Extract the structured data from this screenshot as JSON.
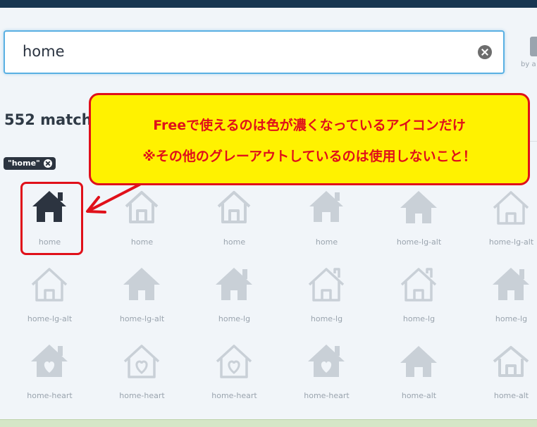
{
  "search": {
    "value": "home"
  },
  "sort": {
    "label": "by a"
  },
  "results": {
    "count_text": "552 matchi"
  },
  "tag": {
    "label": "\"home\""
  },
  "callout": {
    "line1": "Freeで使えるのは色が濃くなっているアイコンだけ",
    "line2": "※その他のグレーアウトしているのは使用しないこと！"
  },
  "colors": {
    "accent": "#e0101a",
    "callout_bg": "#fff200",
    "active_icon": "#2c3440",
    "inactive_icon": "#c9d0d7"
  },
  "icons": [
    {
      "label": "home",
      "icon": "home-solid-icon",
      "free": true
    },
    {
      "label": "home",
      "icon": "home-outline-icon",
      "free": false
    },
    {
      "label": "home",
      "icon": "home-outline-icon",
      "free": false
    },
    {
      "label": "home",
      "icon": "home-solid-icon",
      "free": false
    },
    {
      "label": "home-lg-alt",
      "icon": "home-lg-alt-solid-icon",
      "free": false
    },
    {
      "label": "home-lg-alt",
      "icon": "home-lg-alt-outline-icon",
      "free": false
    },
    {
      "label": "home-lg-alt",
      "icon": "home-lg-alt-outline-icon",
      "free": false
    },
    {
      "label": "home-lg-alt",
      "icon": "home-lg-alt-solid-icon",
      "free": false
    },
    {
      "label": "home-lg",
      "icon": "home-lg-solid-icon",
      "free": false
    },
    {
      "label": "home-lg",
      "icon": "home-lg-outline-icon",
      "free": false
    },
    {
      "label": "home-lg",
      "icon": "home-lg-outline-icon",
      "free": false
    },
    {
      "label": "home-lg",
      "icon": "home-lg-solid-icon",
      "free": false
    },
    {
      "label": "home-heart",
      "icon": "home-heart-solid-icon",
      "free": false
    },
    {
      "label": "home-heart",
      "icon": "home-heart-outline-icon",
      "free": false
    },
    {
      "label": "home-heart",
      "icon": "home-heart-outline-icon",
      "free": false
    },
    {
      "label": "home-heart",
      "icon": "home-heart-solid-icon",
      "free": false
    },
    {
      "label": "home-alt",
      "icon": "home-alt-solid-icon",
      "free": false
    },
    {
      "label": "home-alt",
      "icon": "home-alt-outline-icon",
      "free": false
    }
  ]
}
